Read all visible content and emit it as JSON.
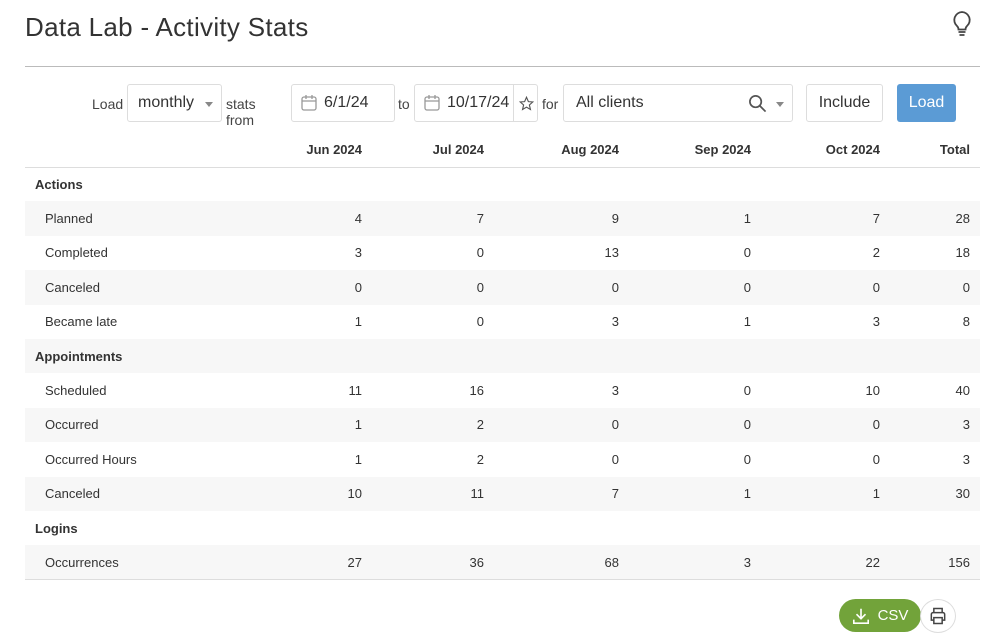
{
  "header": {
    "title": "Data Lab - Activity Stats",
    "icon": "lightbulb-icon"
  },
  "toolbar": {
    "load_label": "Load",
    "period": "monthly",
    "stats_from_label": "stats from",
    "from_date": "6/1/24",
    "to_label": "to",
    "to_date": "10/17/24",
    "for_label": "for",
    "clients": "All clients",
    "include_label": "Include",
    "load_button": "Load",
    "accent": "#5b9bd5"
  },
  "table": {
    "columns": [
      "",
      "Jun 2024",
      "Jul 2024",
      "Aug 2024",
      "Sep 2024",
      "Oct 2024",
      "Total"
    ],
    "rows": [
      {
        "section": "Actions"
      },
      {
        "label": "Planned",
        "values": [
          "4",
          "7",
          "9",
          "1",
          "7",
          "28"
        ]
      },
      {
        "label": "Completed",
        "values": [
          "3",
          "0",
          "13",
          "0",
          "2",
          "18"
        ]
      },
      {
        "label": "Canceled",
        "values": [
          "0",
          "0",
          "0",
          "0",
          "0",
          "0"
        ]
      },
      {
        "label": "Became late",
        "values": [
          "1",
          "0",
          "3",
          "1",
          "3",
          "8"
        ]
      },
      {
        "section": "Appointments"
      },
      {
        "label": "Scheduled",
        "values": [
          "11",
          "16",
          "3",
          "0",
          "10",
          "40"
        ]
      },
      {
        "label": "Occurred",
        "values": [
          "1",
          "2",
          "0",
          "0",
          "0",
          "3"
        ]
      },
      {
        "label": "Occurred Hours",
        "values": [
          "1",
          "2",
          "0",
          "0",
          "0",
          "3"
        ]
      },
      {
        "label": "Canceled",
        "values": [
          "10",
          "11",
          "7",
          "1",
          "1",
          "30"
        ]
      },
      {
        "section": "Logins"
      },
      {
        "label": "Occurrences",
        "values": [
          "27",
          "36",
          "68",
          "3",
          "22",
          "156"
        ]
      }
    ]
  },
  "footer": {
    "csv_label": "CSV",
    "csv_color": "#72a33a"
  }
}
